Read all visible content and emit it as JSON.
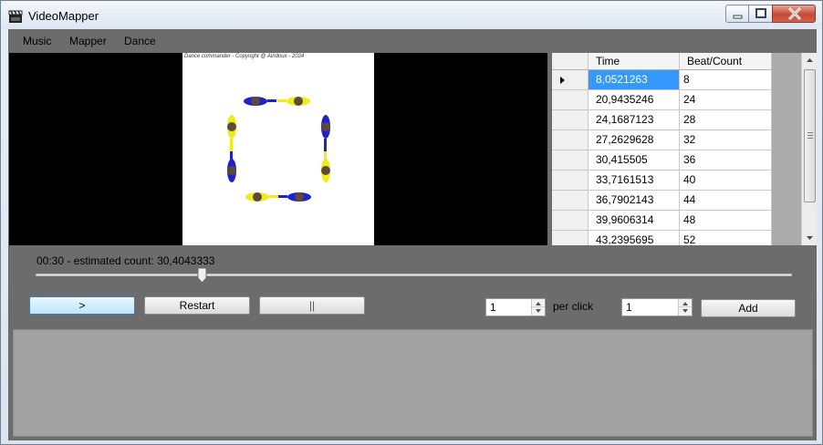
{
  "window": {
    "title": "VideoMapper",
    "icon": "clapperboard-icon",
    "caption_buttons": [
      "minimize-icon",
      "maximize-icon",
      "close-icon"
    ]
  },
  "menu": {
    "items": [
      {
        "label": "Music"
      },
      {
        "label": "Mapper"
      },
      {
        "label": "Dance"
      }
    ]
  },
  "video": {
    "overlay_text": "Dance commander - Copyright @ Aindoux - 2024"
  },
  "grid": {
    "columns": [
      "Time",
      "Beat/Count"
    ],
    "rows": [
      {
        "time": "8,0521263",
        "beat": "8"
      },
      {
        "time": "20,9435246",
        "beat": "24"
      },
      {
        "time": "24,1687123",
        "beat": "28"
      },
      {
        "time": "27,2629628",
        "beat": "32"
      },
      {
        "time": "30,415505",
        "beat": "36"
      },
      {
        "time": "33,7161513",
        "beat": "40"
      },
      {
        "time": "36,7902143",
        "beat": "44"
      },
      {
        "time": "39,9606314",
        "beat": "48"
      },
      {
        "time": "43,2395695",
        "beat": "52"
      }
    ]
  },
  "playback": {
    "status": "00:30 - estimated count: 30,4043333",
    "position_fraction": 0.22,
    "play_label": ">",
    "restart_label": "Restart",
    "pause_label": "||"
  },
  "counter": {
    "count_value": "1",
    "per_click_label": "per click",
    "beat_value": "1",
    "add_label": "Add"
  },
  "colors": {
    "client_bg": "#6c6c6c",
    "selection": "#3399ff",
    "dancer_blue": "#1f22c8",
    "dancer_yellow": "#f2ea1a"
  }
}
